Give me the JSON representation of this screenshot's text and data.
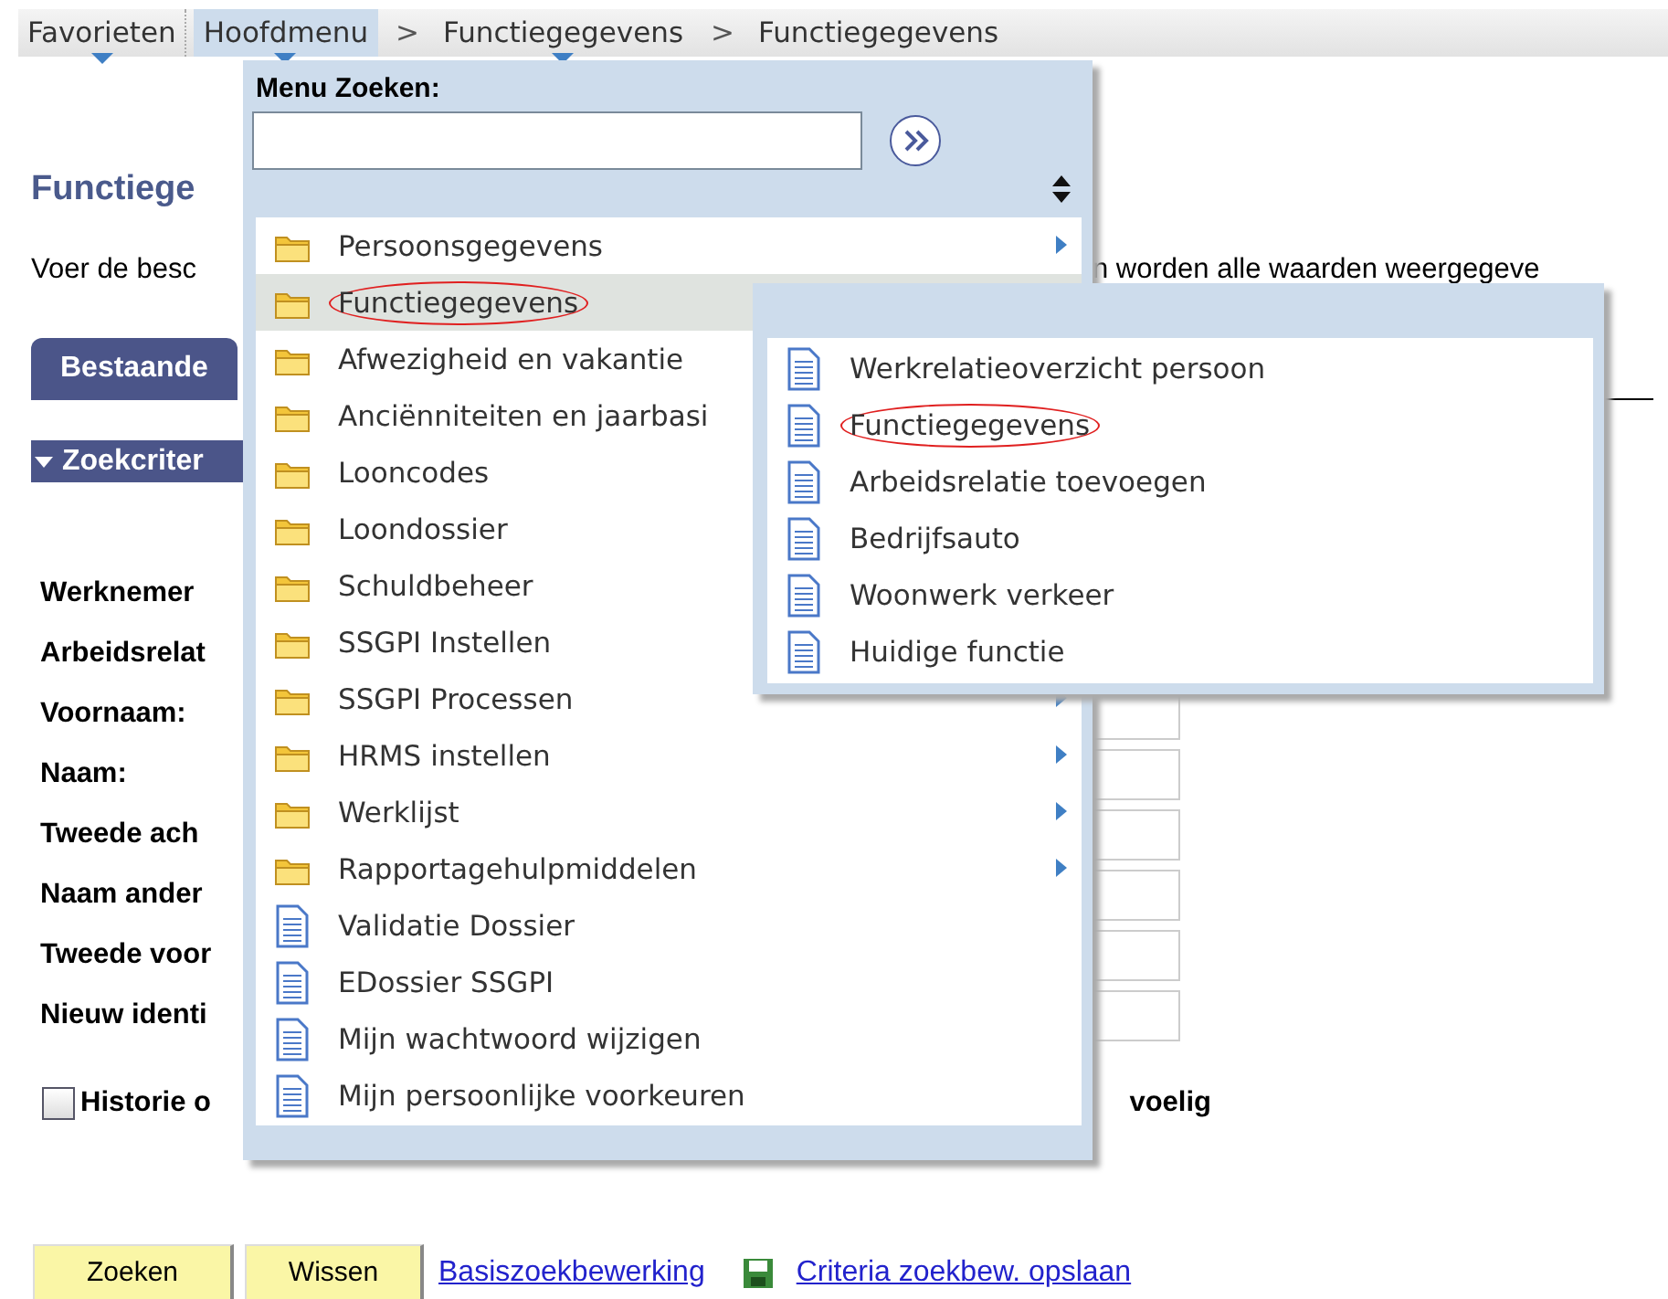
{
  "breadcrumb": [
    {
      "label": "Favorieten",
      "dropdown": true,
      "active": false
    },
    {
      "label": "Hoofdmenu",
      "dropdown": true,
      "active": true
    },
    {
      "label": "Functiegegevens",
      "separator": ">",
      "dropdown": true,
      "active": false
    },
    {
      "label": "Functiegegevens",
      "separator": ">",
      "dropdown": false,
      "active": false
    }
  ],
  "page": {
    "title": "Functiege",
    "description_start": "Voer de besc",
    "description_end": "n worden alle waarden weergegeve",
    "tab": "Bestaande",
    "section": "Zoekcriter",
    "fields": [
      {
        "label": "Werknemer",
        "field_visible": false
      },
      {
        "label": "Arbeidsrelat",
        "field_visible": false
      },
      {
        "label": "Voornaam:",
        "field_visible": true
      },
      {
        "label": "Naam:",
        "field_visible": true
      },
      {
        "label": "Tweede ach",
        "field_visible": true
      },
      {
        "label": "Naam ander",
        "field_visible": true
      },
      {
        "label": "Tweede voor",
        "field_visible": true
      },
      {
        "label": "Nieuw identi",
        "field_visible": true
      }
    ],
    "checkbox": {
      "label_start": "Historie o",
      "label_end": "voelig",
      "checked": false
    },
    "buttons": [
      "Zoeken",
      "Wissen"
    ],
    "links": [
      {
        "label": "Basiszoekbewerking",
        "kind": "plain"
      },
      {
        "label": "Criteria zoekbew. opslaan",
        "kind": "save"
      }
    ]
  },
  "menu": {
    "search_label": "Menu Zoeken:",
    "items": [
      {
        "label": "Persoonsgegevens",
        "kind": "folder",
        "submenu_arrow": true,
        "selected": false,
        "circled": false
      },
      {
        "label": "Functiegegevens",
        "kind": "folder",
        "submenu_arrow": false,
        "selected": true,
        "circled": true
      },
      {
        "label": "Afwezigheid en vakantie",
        "kind": "folder",
        "submenu_arrow": false,
        "selected": false,
        "circled": false
      },
      {
        "label": "Anciënniteiten en jaarbasi",
        "kind": "folder",
        "submenu_arrow": false,
        "selected": false,
        "circled": false
      },
      {
        "label": "Looncodes",
        "kind": "folder",
        "submenu_arrow": false,
        "selected": false,
        "circled": false
      },
      {
        "label": "Loondossier",
        "kind": "folder",
        "submenu_arrow": false,
        "selected": false,
        "circled": false
      },
      {
        "label": "Schuldbeheer",
        "kind": "folder",
        "submenu_arrow": false,
        "selected": false,
        "circled": false
      },
      {
        "label": "SSGPI Instellen",
        "kind": "folder",
        "submenu_arrow": false,
        "selected": false,
        "circled": false
      },
      {
        "label": "SSGPI Processen",
        "kind": "folder",
        "submenu_arrow": true,
        "selected": false,
        "circled": false
      },
      {
        "label": "HRMS instellen",
        "kind": "folder",
        "submenu_arrow": true,
        "selected": false,
        "circled": false
      },
      {
        "label": "Werklijst",
        "kind": "folder",
        "submenu_arrow": true,
        "selected": false,
        "circled": false
      },
      {
        "label": "Rapportagehulpmiddelen",
        "kind": "folder",
        "submenu_arrow": true,
        "selected": false,
        "circled": false
      },
      {
        "label": "Validatie Dossier",
        "kind": "page",
        "submenu_arrow": false,
        "selected": false,
        "circled": false
      },
      {
        "label": "EDossier SSGPI",
        "kind": "page",
        "submenu_arrow": false,
        "selected": false,
        "circled": false
      },
      {
        "label": "Mijn wachtwoord wijzigen",
        "kind": "page",
        "submenu_arrow": false,
        "selected": false,
        "circled": false
      },
      {
        "label": "Mijn persoonlijke voorkeuren",
        "kind": "page",
        "submenu_arrow": false,
        "selected": false,
        "circled": false
      }
    ],
    "submenu": {
      "items": [
        {
          "label": "Werkrelatieoverzicht persoon",
          "kind": "page",
          "circled": false
        },
        {
          "label": "Functiegegevens",
          "kind": "page",
          "circled": true
        },
        {
          "label": "Arbeidsrelatie toevoegen",
          "kind": "page",
          "circled": false
        },
        {
          "label": "Bedrijfsauto",
          "kind": "page",
          "circled": false
        },
        {
          "label": "Woonwerk verkeer",
          "kind": "page",
          "circled": false
        },
        {
          "label": "Huidige functie",
          "kind": "page",
          "circled": false
        }
      ]
    }
  }
}
